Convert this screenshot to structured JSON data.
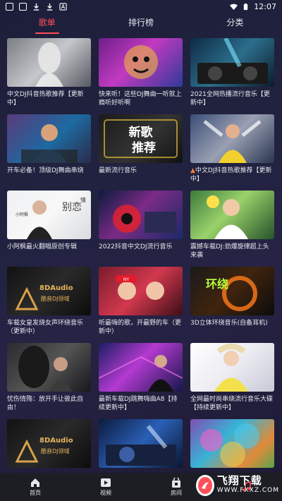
{
  "status_bar": {
    "time": "12:07",
    "left_icons": [
      "notification-box-icon",
      "notification-box-icon",
      "download-icon",
      "download-icon",
      "a-icon"
    ],
    "right_icons": [
      "wifi-icon",
      "battery-icon"
    ]
  },
  "tabs": [
    {
      "label": "歌单",
      "active": true
    },
    {
      "label": "排行榜",
      "active": false
    },
    {
      "label": "分类",
      "active": false
    }
  ],
  "thumb_text": {
    "new_song_1": "新歌",
    "new_song_2": "推荐",
    "author_side": "小阿枫",
    "author_title": "别恋",
    "author_title_sub": "情",
    "brand": "8DAudio",
    "brand_sub": "酷音DJ领域",
    "ring_text": "环绕",
    "cap_text": "NY"
  },
  "playlists": [
    {
      "title": "中文DJ抖音热歌推荐【更新中】",
      "icon": "",
      "thumb": "t0"
    },
    {
      "title": "快来听！这些DJ舞曲一听就上瘾听好听啊",
      "icon": "",
      "thumb": "t1"
    },
    {
      "title": "2021全网热播流行音乐【更新中】",
      "icon": "",
      "thumb": "t2"
    },
    {
      "title": "开车必备！顶级DJ舞曲串烧",
      "icon": "",
      "thumb": "t3"
    },
    {
      "title": "最新流行音乐",
      "icon": "",
      "thumb": "t4"
    },
    {
      "title": "中文DJ抖音热歌推荐【更新中】",
      "icon": "fire-icon",
      "thumb": "t5"
    },
    {
      "title": "小阿枫最火翻唱原创专辑",
      "icon": "",
      "thumb": "t6"
    },
    {
      "title": "2022抖音中文DJ流行音乐",
      "icon": "",
      "thumb": "t7"
    },
    {
      "title": "震撼车载DJ:劲爆旋律超上头来袭",
      "icon": "",
      "thumb": "t8"
    },
    {
      "title": "车载女皇发烧女声环绕音乐（更新中）",
      "icon": "",
      "thumb": "t9"
    },
    {
      "title": "听最嗨的歌，开最野的车（更新中）",
      "icon": "",
      "thumb": "t10"
    },
    {
      "title": "3D立体环绕音乐(自备耳机)",
      "icon": "",
      "thumb": "t11"
    },
    {
      "title": "忧伤情殇：放开手让彼此自由！",
      "icon": "",
      "thumb": "t12"
    },
    {
      "title": "最新车载DJ跳舞嗨曲A8【持续更新中】",
      "icon": "",
      "thumb": "t13"
    },
    {
      "title": "全网最时尚串烧流行音乐大碟【持续更新中】",
      "icon": "",
      "thumb": "t14"
    },
    {
      "title": "",
      "icon": "",
      "thumb": "t15"
    },
    {
      "title": "",
      "icon": "",
      "thumb": "t16"
    },
    {
      "title": "",
      "icon": "",
      "thumb": "t17"
    }
  ],
  "bottom_nav": [
    {
      "label": "首页",
      "icon": "home-icon",
      "active": false
    },
    {
      "label": "视频",
      "icon": "video-play-icon",
      "active": false
    },
    {
      "label": "房间",
      "icon": "room-icon",
      "active": false
    },
    {
      "label": "",
      "icon": "music-icon",
      "active": true
    }
  ],
  "watermark": {
    "main": "飞翔下载",
    "sub": "WWW.FXXZ.COM"
  },
  "colors": {
    "accent": "#ff4f58",
    "background": "#20223f",
    "nav_bg": "#1c1e24"
  }
}
